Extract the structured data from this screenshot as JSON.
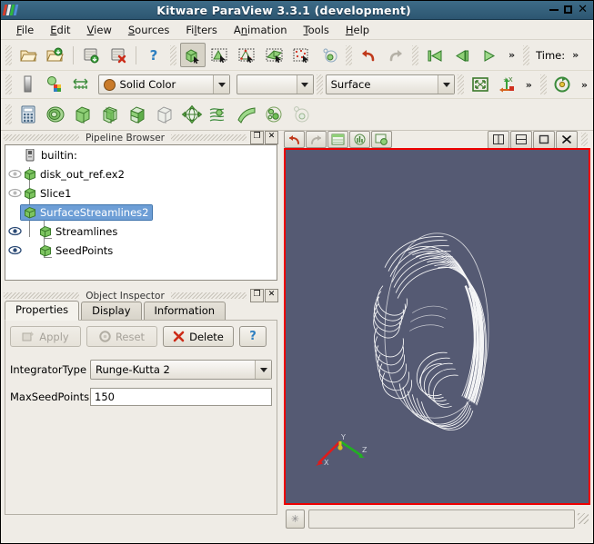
{
  "window": {
    "title": "Kitware ParaView 3.3.1 (development)",
    "logo_icon": "paraview-stripes-icon",
    "minimize_label": "minimize-icon",
    "maximize_label": "maximize-icon",
    "close_label": "close-icon"
  },
  "menubar": {
    "items": [
      {
        "label": "File",
        "mnemonic": "F"
      },
      {
        "label": "Edit",
        "mnemonic": "E"
      },
      {
        "label": "View",
        "mnemonic": "V"
      },
      {
        "label": "Sources",
        "mnemonic": "S"
      },
      {
        "label": "Filters",
        "mnemonic": "l"
      },
      {
        "label": "Animation",
        "mnemonic": "n"
      },
      {
        "label": "Tools",
        "mnemonic": "T"
      },
      {
        "label": "Help",
        "mnemonic": "H"
      }
    ]
  },
  "toolbar_main": {
    "buttons": [
      {
        "name": "open-file-icon",
        "title": "Open"
      },
      {
        "name": "open-recent-icon",
        "title": "Open recent"
      },
      {
        "name": "save-data-icon",
        "title": "Save Data"
      },
      {
        "name": "delete-data-icon",
        "title": "Delete Data"
      },
      {
        "name": "help-icon",
        "title": "Help"
      },
      {
        "name": "select-cells-icon",
        "title": "Select Cells On"
      },
      {
        "name": "select-points-icon",
        "title": "Select Points On"
      },
      {
        "name": "select-points-through-icon",
        "title": "Select Points Through"
      },
      {
        "name": "select-surface-cells-icon",
        "title": "Select Surface Cells"
      },
      {
        "name": "select-frustum-icon",
        "title": "Select Frustum"
      },
      {
        "name": "select-blocks-icon",
        "title": "Select Blocks"
      },
      {
        "name": "undo-icon",
        "title": "Undo"
      },
      {
        "name": "redo-icon",
        "title": "Redo"
      }
    ],
    "vcr": [
      {
        "name": "first-frame-icon",
        "title": "First Frame"
      },
      {
        "name": "previous-frame-icon",
        "title": "Previous Frame"
      },
      {
        "name": "play-icon",
        "title": "Play"
      }
    ],
    "overflow_label": "»",
    "time_label": "Time:",
    "time_overflow_label": "»"
  },
  "toolbar_display": {
    "buttons": [
      {
        "name": "color-scale-icon",
        "title": "Edit Color Map"
      },
      {
        "name": "rescale-range-icon",
        "title": "Rescale to Data Range"
      },
      {
        "name": "scalar-bar-icon",
        "title": "Toggle Scalar Bar"
      }
    ],
    "color_by": {
      "value": "Solid Color",
      "swatch_color": "#c97b2a"
    },
    "array_component": {
      "value": ""
    },
    "representation": {
      "value": "Surface"
    },
    "right_buttons": [
      {
        "name": "zoom-to-data-icon",
        "title": "Zoom To Data"
      },
      {
        "name": "change-center-axes-icon",
        "title": "Change Center Axes"
      },
      {
        "name": "camera-undo-icon",
        "title": "Camera Undo"
      }
    ],
    "overflow_label": "»",
    "overflow_label2": "»"
  },
  "toolbar_filters": {
    "buttons": [
      {
        "name": "calculator-icon",
        "title": "Calculator"
      },
      {
        "name": "contour-icon",
        "title": "Contour"
      },
      {
        "name": "clip-icon",
        "title": "Clip"
      },
      {
        "name": "slice-icon",
        "title": "Slice"
      },
      {
        "name": "threshold-icon",
        "title": "Threshold"
      },
      {
        "name": "extract-subset-icon",
        "title": "Extract Subset"
      },
      {
        "name": "glyph-icon",
        "title": "Glyph"
      },
      {
        "name": "stream-tracer-icon",
        "title": "Stream Tracer"
      },
      {
        "name": "warp-icon",
        "title": "Warp By Vector"
      },
      {
        "name": "group-datasets-icon",
        "title": "Group Datasets"
      },
      {
        "name": "extract-level-icon",
        "title": "Extract Level"
      }
    ]
  },
  "pipeline_browser": {
    "title": "Pipeline Browser",
    "dock_float_label": "❐",
    "dock_close_label": "✕",
    "items": [
      {
        "label": "builtin:",
        "icon": "server-icon",
        "eye": "none",
        "indent": 0,
        "selected": false
      },
      {
        "label": "disk_out_ref.ex2",
        "icon": "dataset-cube-icon",
        "eye": "off",
        "indent": 0,
        "selected": false
      },
      {
        "label": "Slice1",
        "icon": "dataset-cube-icon",
        "eye": "off",
        "indent": 0,
        "selected": false
      },
      {
        "label": "SurfaceStreamlines2",
        "icon": "dataset-cube-icon",
        "eye": "none",
        "indent": 0,
        "selected": true
      },
      {
        "label": "Streamlines",
        "icon": "dataset-cube-icon",
        "eye": "on",
        "indent": 1,
        "selected": false
      },
      {
        "label": "SeedPoints",
        "icon": "dataset-cube-icon",
        "eye": "on",
        "indent": 1,
        "selected": false
      }
    ]
  },
  "object_inspector": {
    "title": "Object Inspector",
    "dock_float_label": "❐",
    "dock_close_label": "✕",
    "tabs": [
      {
        "label": "Properties",
        "active": true
      },
      {
        "label": "Display",
        "active": false
      },
      {
        "label": "Information",
        "active": false
      }
    ],
    "buttons": [
      {
        "label": "Apply",
        "name": "apply-button",
        "enabled": false,
        "icon": "apply-icon"
      },
      {
        "label": "Reset",
        "name": "reset-button",
        "enabled": false,
        "icon": "reset-icon"
      },
      {
        "label": "Delete",
        "name": "delete-button",
        "enabled": true,
        "icon": "delete-x-icon"
      },
      {
        "label": "?",
        "name": "help-button",
        "enabled": true,
        "icon": "question-icon"
      }
    ],
    "properties": [
      {
        "label": "IntegratorType",
        "value": "Runge-Kutta 2",
        "type": "combo"
      },
      {
        "label": "MaxSeedPoints",
        "value": "150",
        "type": "text"
      }
    ]
  },
  "render_view": {
    "toolbar_left": [
      {
        "name": "camera-undo-icon",
        "title": "Camera Undo"
      },
      {
        "name": "camera-redo-icon",
        "title": "Camera Redo"
      },
      {
        "name": "spreadsheet-view-icon",
        "title": "Spreadsheet View"
      },
      {
        "name": "histogram-view-icon",
        "title": "Histogram View"
      },
      {
        "name": "render-view-icon",
        "title": "3D View"
      }
    ],
    "toolbar_right": [
      {
        "name": "split-horizontal-icon",
        "label": "▥",
        "title": "Split Horizontal"
      },
      {
        "name": "split-vertical-icon",
        "label": "▤",
        "title": "Split Vertical"
      },
      {
        "name": "maximize-view-icon",
        "label": "□",
        "title": "Maximize"
      },
      {
        "name": "close-view-icon",
        "label": "✕",
        "title": "Close"
      }
    ],
    "background_color": "#555a73",
    "active_border_color": "#ee0000",
    "streamline_color": "#ffffff",
    "orientation_axes": [
      {
        "label": "X",
        "color": "#e01b1b"
      },
      {
        "label": "Y",
        "color": "#d8c020"
      },
      {
        "label": "Z",
        "color": "#22b022"
      }
    ]
  },
  "status_bar": {
    "abort_label": "✳",
    "progress_text": ""
  }
}
